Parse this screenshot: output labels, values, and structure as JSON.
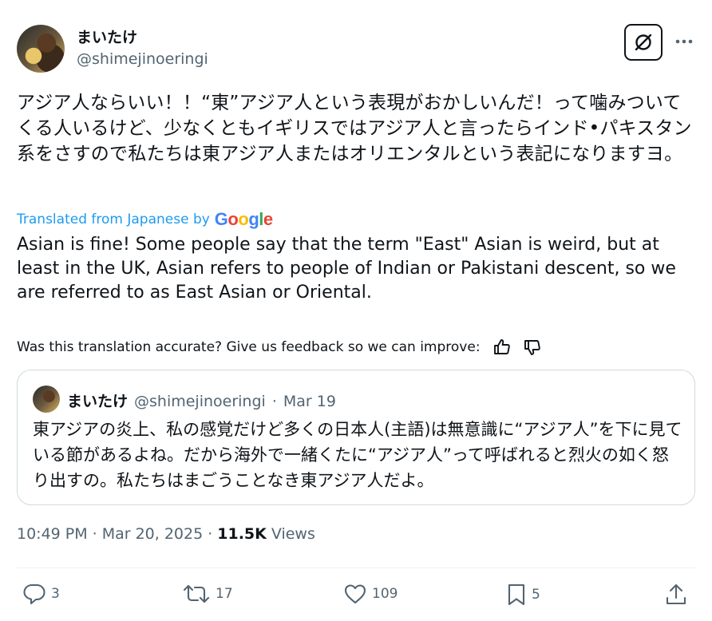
{
  "author": {
    "name": "まいたけ",
    "handle": "@shimejinoeringi",
    "avatar_icon": "avatar-photo"
  },
  "tweet": {
    "text": "アジア人ならいい！！“東”アジア人という表現がおかしいんだ！って噛みついてくる人いるけど、少なくともイギリスではアジア人と言ったらインド•パキスタン系をさすので私たちは東アジア人またはオリエンタルという表記になりますヨ。",
    "translated_label": "Translated from Japanese by",
    "google_label": "Google",
    "translation": "Asian is fine! Some people say that the term \"East\" Asian is weird, but at least in the UK, Asian refers to people of Indian or Pakistani descent, so we are referred to as East Asian or Oriental.",
    "feedback_label": "Was this translation accurate? Give us feedback so we can improve:"
  },
  "quote": {
    "name": "まいたけ",
    "handle": "@shimejinoeringi",
    "separator": "·",
    "date": "Mar 19",
    "text": "東アジアの炎上、私の感覚だけど多くの日本人(主語)は無意識に“アジア人”を下に見ている節があるよね。だから海外で一緒くたに“アジア人”って呼ばれると烈火の如く怒り出すの。私たちはまごうことなき東アジア人だよ。"
  },
  "meta": {
    "time": "10:49 PM",
    "sep1": "·",
    "date": "Mar 20, 2025",
    "sep2": "·",
    "views_count": "11.5K",
    "views_label": "Views"
  },
  "actions": {
    "replies": "3",
    "reposts": "17",
    "likes": "109",
    "bookmarks": "5"
  },
  "colors": {
    "accent": "#1d9bf0",
    "text": "#0f1419",
    "secondary": "#536471",
    "border": "#cfd9de"
  }
}
